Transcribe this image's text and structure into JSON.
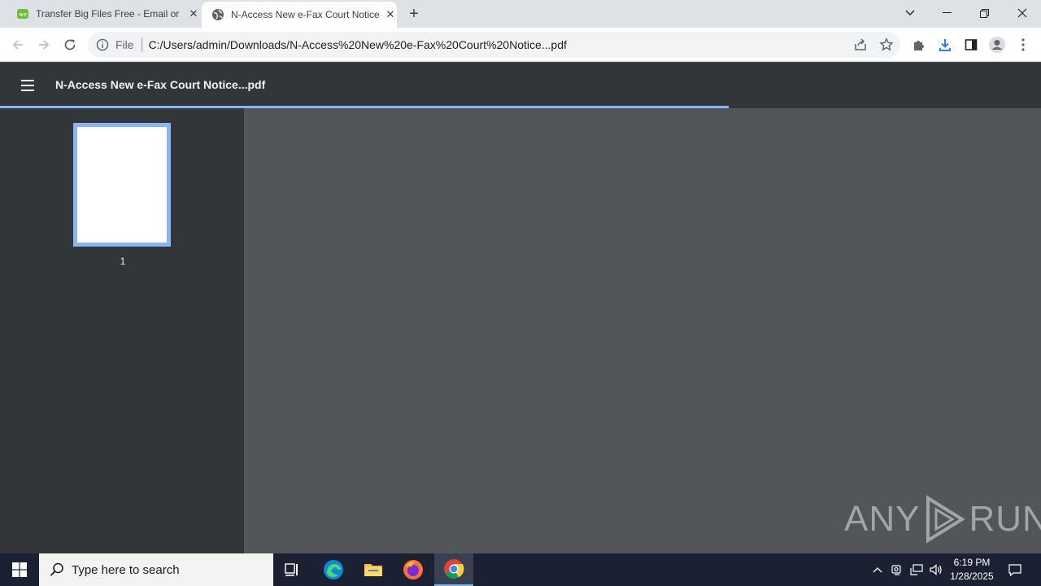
{
  "browser": {
    "tabs": [
      {
        "title": "Transfer Big Files Free - Email or",
        "active": false,
        "icon": "wetransfer-favicon"
      },
      {
        "title": "N-Access New e-Fax Court Notice",
        "active": true,
        "icon": "globe-icon"
      }
    ],
    "omnibox": {
      "scheme_label": "File",
      "url": "C:/Users/admin/Downloads/N-Access%20New%20e-Fax%20Court%20Notice...pdf"
    }
  },
  "pdf_viewer": {
    "title": "N-Access New e-Fax Court Notice...pdf",
    "load_progress": 0.7,
    "thumbnails": [
      {
        "page": "1",
        "selected": true
      }
    ]
  },
  "watermark": {
    "left": "ANY",
    "right": "RUN"
  },
  "taskbar": {
    "search_placeholder": "Type here to search",
    "clock_time": "6:19 PM",
    "clock_date": "1/28/2025"
  },
  "colors": {
    "accent": "#8ab4f8",
    "pdf_toolbar": "#323639",
    "pdf_background": "#525659",
    "taskbar": "#1c2033"
  }
}
